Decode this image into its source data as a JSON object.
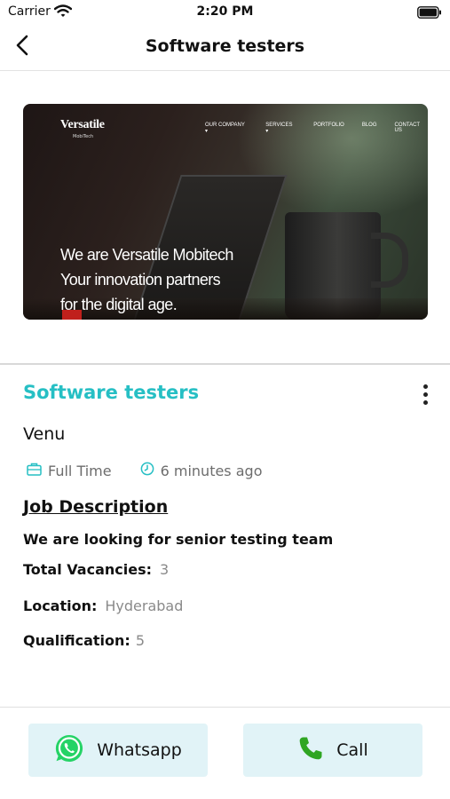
{
  "status_bar": {
    "carrier": "Carrier",
    "time": "2:20 PM"
  },
  "nav": {
    "title": "Software testers"
  },
  "banner": {
    "logo": "Versatile",
    "logo_sub": "MobiTech",
    "menu": [
      "OUR COMPANY ▾",
      "SERVICES ▾",
      "PORTFOLIO",
      "BLOG",
      "CONTACT US"
    ],
    "tagline": [
      "We are Versatile Mobitech",
      "Your innovation partners",
      "for the digital age."
    ]
  },
  "job": {
    "title": "Software testers",
    "company": "Venu",
    "type": "Full Time",
    "posted": "6 minutes ago",
    "description_heading": "Job Description",
    "description": "We are looking for senior testing team",
    "fields": {
      "vacancies": {
        "label": "Total Vacancies:",
        "value": "3"
      },
      "location": {
        "label": "Location:",
        "value": "Hyderabad"
      },
      "qualification": {
        "label": "Qualification:",
        "value": "5"
      }
    }
  },
  "actions": {
    "whatsapp": "Whatsapp",
    "call": "Call"
  },
  "colors": {
    "accent": "#26bfc4",
    "button_bg": "#e1f3f7",
    "whatsapp_green": "#25d366",
    "call_green": "#2fa523"
  },
  "icons": {
    "back": "chevron-left-icon",
    "more": "vertical-dots-icon",
    "job_type": "briefcase-icon",
    "posted": "clock-icon"
  }
}
